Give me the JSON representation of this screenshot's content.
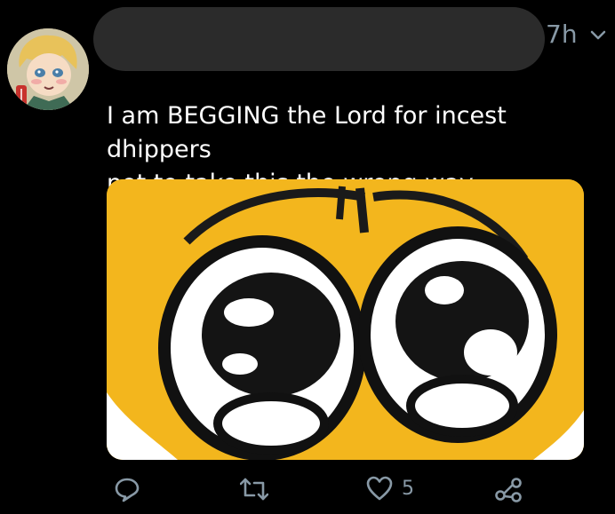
{
  "tweet": {
    "timestamp": "7h",
    "text": "I am BEGGING the Lord for incest dhippers\nnot to take this the wrong way",
    "like_count": "5"
  },
  "icons": {
    "more": "chevron-down-icon",
    "reply": "reply-icon",
    "retweet": "retweet-icon",
    "like": "heart-icon",
    "share": "share-icon"
  },
  "colors": {
    "background": "#000000",
    "text": "#ffffff",
    "muted": "#8899a6",
    "media_yellow": "#f3b61d"
  }
}
